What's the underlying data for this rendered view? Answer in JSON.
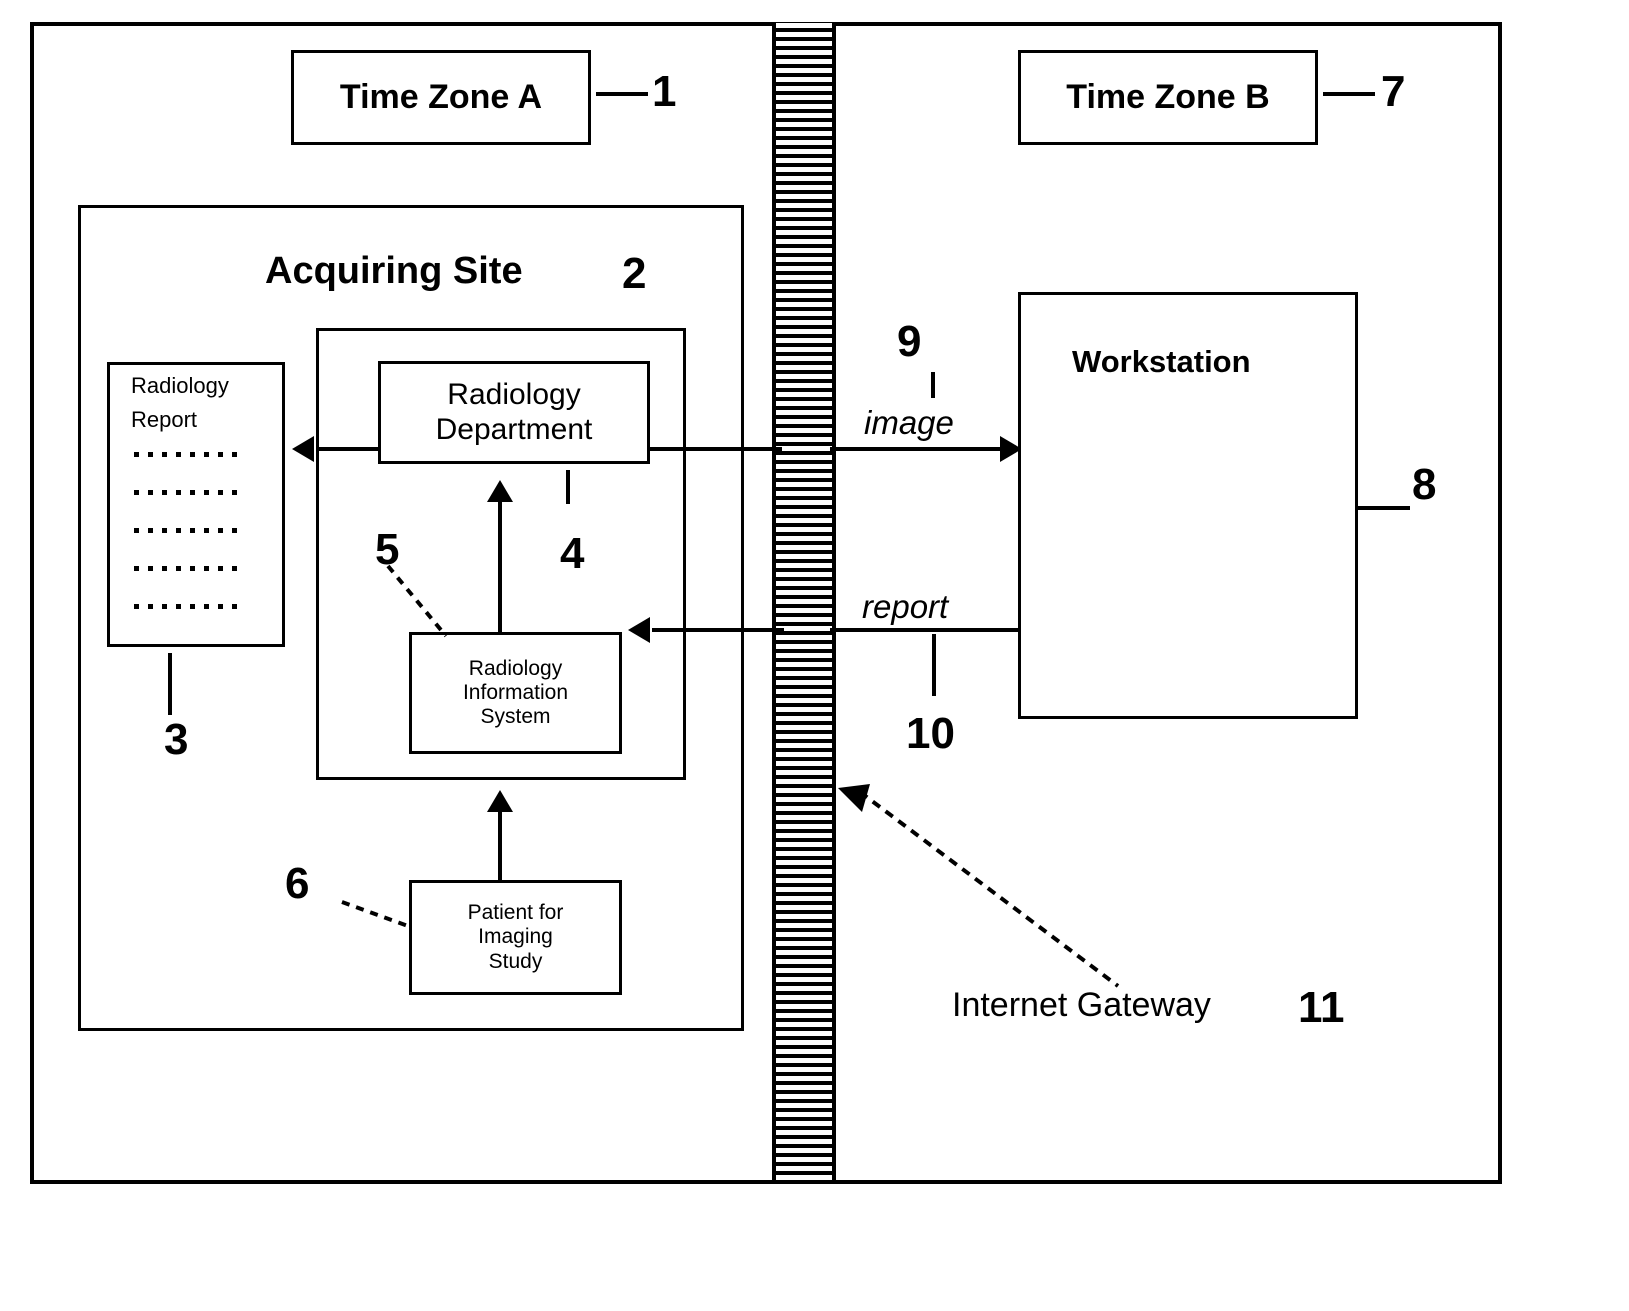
{
  "diagram": {
    "zones": {
      "zone_a": {
        "label": "Time Zone A",
        "ref": "1"
      },
      "zone_b": {
        "label": "Time Zone B",
        "ref": "7"
      }
    },
    "acquiring_site": {
      "label": "Acquiring Site",
      "ref": "2"
    },
    "radiology_report": {
      "title_line1": "Radiology",
      "title_line2": "Report",
      "ref": "3",
      "dotted_line_count": 5
    },
    "radiology_department": {
      "line1": "Radiology",
      "line2": "Department",
      "ref": "4"
    },
    "radiology_information_system": {
      "line1": "Radiology",
      "line2": "Information",
      "line3": "System",
      "ref": "5"
    },
    "patient": {
      "line1": "Patient for",
      "line2": "Imaging",
      "line3": "Study",
      "ref": "6"
    },
    "workstation": {
      "label": "Workstation",
      "ref": "8"
    },
    "flows": {
      "image": {
        "label": "image",
        "ref": "9"
      },
      "report": {
        "label": "report",
        "ref": "10"
      }
    },
    "gateway": {
      "label": "Internet Gateway",
      "ref": "11"
    }
  },
  "colors": {
    "ink": "#000000",
    "paper": "#ffffff"
  }
}
